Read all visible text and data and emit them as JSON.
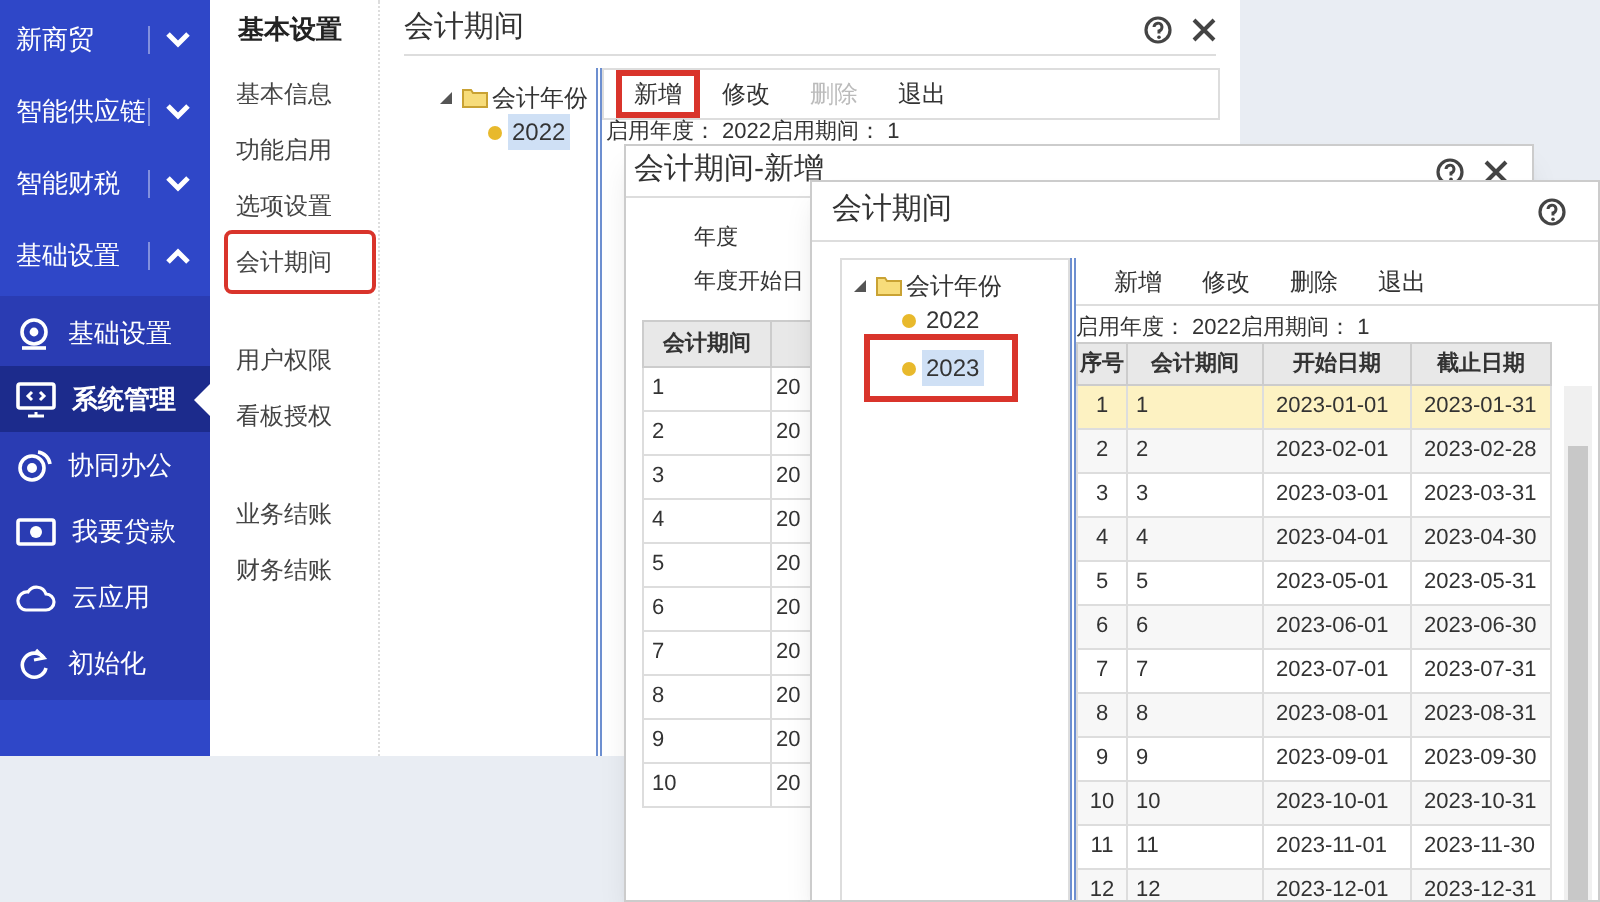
{
  "sidebar": {
    "groups": [
      {
        "label": "新商贸",
        "expanded": false
      },
      {
        "label": "智能供应链",
        "expanded": false
      },
      {
        "label": "智能财税",
        "expanded": false
      },
      {
        "label": "基础设置",
        "expanded": true
      }
    ],
    "items": [
      {
        "label": "基础设置",
        "kind": "camera",
        "selected": false
      },
      {
        "label": "系统管理",
        "kind": "monitor",
        "selected": true
      },
      {
        "label": "协同办公",
        "kind": "ring",
        "selected": false
      },
      {
        "label": "我要贷款",
        "kind": "cash",
        "selected": false
      },
      {
        "label": "云应用",
        "kind": "cloud",
        "selected": false
      },
      {
        "label": "初始化",
        "kind": "refresh",
        "selected": false
      }
    ]
  },
  "submenu": {
    "title": "基本设置",
    "sections": [
      {
        "items": [
          {
            "label": "基本信息",
            "highlighted": false
          },
          {
            "label": "功能启用",
            "highlighted": false
          },
          {
            "label": "选项设置",
            "highlighted": false
          },
          {
            "label": "会计期间",
            "highlighted": true
          }
        ]
      },
      {
        "items": [
          {
            "label": "用户权限",
            "highlighted": false
          },
          {
            "label": "看板授权",
            "highlighted": false
          }
        ]
      },
      {
        "items": [
          {
            "label": "业务结账",
            "highlighted": false
          },
          {
            "label": "财务结账",
            "highlighted": false
          }
        ]
      }
    ]
  },
  "window_1": {
    "title": "会计期间",
    "tree": {
      "label": "会计年份",
      "expanded": true,
      "children": [
        {
          "label": "2022",
          "selected": true,
          "highlighted": false
        }
      ]
    },
    "toolbar": [
      {
        "label": "新增",
        "disabled": false,
        "highlighted": true
      },
      {
        "label": "修改",
        "disabled": false,
        "highlighted": false
      },
      {
        "label": "删除",
        "disabled": true,
        "highlighted": false
      },
      {
        "label": "退出",
        "disabled": false,
        "highlighted": false
      }
    ],
    "info": "启用年度： 2022启用期间： 1"
  },
  "window_2": {
    "title": "会计期间-新增",
    "fields": [
      {
        "label": "年度"
      },
      {
        "label": "年度开始日"
      }
    ],
    "table": {
      "columns": [
        "会计期间"
      ],
      "rows": [
        {
          "cells": [
            "1",
            "20"
          ]
        },
        {
          "cells": [
            "2",
            "20"
          ]
        },
        {
          "cells": [
            "3",
            "20"
          ]
        },
        {
          "cells": [
            "4",
            "20"
          ]
        },
        {
          "cells": [
            "5",
            "20"
          ]
        },
        {
          "cells": [
            "6",
            "20"
          ]
        },
        {
          "cells": [
            "7",
            "20"
          ]
        },
        {
          "cells": [
            "8",
            "20"
          ]
        },
        {
          "cells": [
            "9",
            "20"
          ]
        },
        {
          "cells": [
            "10",
            "20"
          ]
        }
      ]
    }
  },
  "window_3": {
    "title": "会计期间",
    "tree": {
      "label": "会计年份",
      "expanded": true,
      "children": [
        {
          "label": "2022",
          "selected": false,
          "highlighted": false
        },
        {
          "label": "2023",
          "selected": true,
          "highlighted": true
        }
      ]
    },
    "toolbar": [
      {
        "label": "新增",
        "disabled": false,
        "highlighted": false
      },
      {
        "label": "修改",
        "disabled": false,
        "highlighted": false
      },
      {
        "label": "删除",
        "disabled": false,
        "highlighted": false
      },
      {
        "label": "退出",
        "disabled": false,
        "highlighted": false
      }
    ],
    "info": "启用年度： 2022启用期间： 1",
    "table": {
      "columns": [
        "序号",
        "会计期间",
        "开始日期",
        "截止日期"
      ],
      "rows": [
        {
          "selected": true,
          "cells": [
            "1",
            "1",
            "2023-01-01",
            "2023-01-31"
          ]
        },
        {
          "selected": false,
          "cells": [
            "2",
            "2",
            "2023-02-01",
            "2023-02-28"
          ]
        },
        {
          "selected": false,
          "cells": [
            "3",
            "3",
            "2023-03-01",
            "2023-03-31"
          ]
        },
        {
          "selected": false,
          "cells": [
            "4",
            "4",
            "2023-04-01",
            "2023-04-30"
          ]
        },
        {
          "selected": false,
          "cells": [
            "5",
            "5",
            "2023-05-01",
            "2023-05-31"
          ]
        },
        {
          "selected": false,
          "cells": [
            "6",
            "6",
            "2023-06-01",
            "2023-06-30"
          ]
        },
        {
          "selected": false,
          "cells": [
            "7",
            "7",
            "2023-07-01",
            "2023-07-31"
          ]
        },
        {
          "selected": false,
          "cells": [
            "8",
            "8",
            "2023-08-01",
            "2023-08-31"
          ]
        },
        {
          "selected": false,
          "cells": [
            "9",
            "9",
            "2023-09-01",
            "2023-09-30"
          ]
        },
        {
          "selected": false,
          "cells": [
            "10",
            "10",
            "2023-10-01",
            "2023-10-31"
          ]
        },
        {
          "selected": false,
          "cells": [
            "11",
            "11",
            "2023-11-01",
            "2023-11-30"
          ]
        },
        {
          "selected": false,
          "cells": [
            "12",
            "12",
            "2023-12-01",
            "2023-12-31"
          ]
        }
      ]
    }
  }
}
